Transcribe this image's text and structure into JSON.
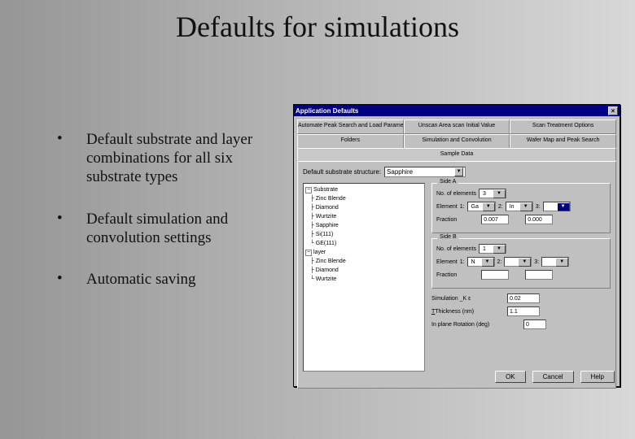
{
  "slide": {
    "title": "Defaults for simulations",
    "bullets": [
      "Default substrate and layer combinations for all six substrate types",
      "Default simulation and convolution settings",
      "Automatic saving"
    ]
  },
  "window": {
    "title": "Application Defaults",
    "close": "×",
    "tabs_row1": [
      "Automate Peak Search and Load Parameters",
      "Unscan Area scan Initial Value",
      "Scan Treatment Options"
    ],
    "tabs_row2": [
      "Folders",
      "Simulation and Convolution",
      "Wafer Map and Peak Search"
    ],
    "active_tab": "Sample Data",
    "substrate_label": "Default substrate structure:",
    "substrate_value": "Sapphire",
    "tree": {
      "root1": "Substrate",
      "r1children": [
        "Zinc Blende",
        "Diamond",
        "Wurtzite",
        "Sapphire",
        "Si(111)",
        "GE(111)"
      ],
      "root2": "layer",
      "r2children": [
        "Zinc Blende",
        "Diamond",
        "Wurtzite"
      ]
    },
    "sideA": {
      "title": "Side A",
      "num_label": "No. of elements",
      "num_value": "3",
      "elem_label": "Element",
      "e1": "1:",
      "e1v": "Ga",
      "e2": "2:",
      "e2v": "In",
      "e3": "3:",
      "e3v": "",
      "frac_label": "Fraction",
      "f1": "0.007",
      "f2": "0.000"
    },
    "sideB": {
      "title": "Side B",
      "num_label": "No. of elements",
      "num_value": "1",
      "elem_label": "Element",
      "e1": "1:",
      "e1v": "N",
      "e2": "2:",
      "e2v": "",
      "e3": "3:",
      "e3v": "",
      "frac_label": "Fraction",
      "f1": "",
      "f2": ""
    },
    "sim_k_label": "Simulation _K ε",
    "sim_k_value": "0.02",
    "thickness_label": "Thickness (nm)",
    "thickness_value": "1.1",
    "rotation_label": "In plane Rotation (deg)",
    "rotation_value": "0",
    "buttons": {
      "ok": "OK",
      "cancel": "Cancel",
      "help": "Help"
    }
  }
}
